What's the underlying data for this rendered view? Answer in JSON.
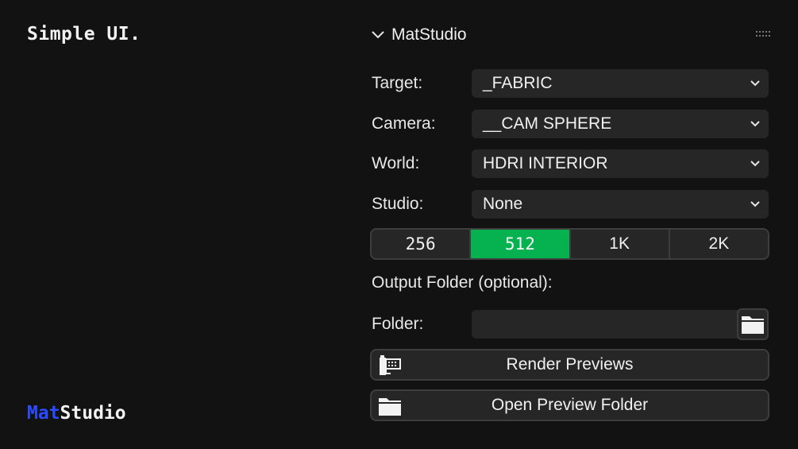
{
  "brand": {
    "top_text": "Simple UI.",
    "bottom_mat": "Mat",
    "bottom_studio": "Studio",
    "accent_color": "#2a4bff"
  },
  "panel": {
    "title": "MatStudio",
    "collapse_icon": "chevron-down-icon",
    "drag_icon": "drag-handle-icon"
  },
  "fields": [
    {
      "label": "Target:",
      "value": "_FABRIC"
    },
    {
      "label": "Camera:",
      "value": "__CAM SPHERE"
    },
    {
      "label": "World:",
      "value": "HDRI INTERIOR"
    },
    {
      "label": "Studio:",
      "value": "None"
    }
  ],
  "resolution": {
    "options": [
      "256",
      "512",
      "1K",
      "2K"
    ],
    "selected": "512",
    "active_color": "#06b24f"
  },
  "output": {
    "section_label": "Output Folder (optional):",
    "folder_label": "Folder:",
    "folder_value": "",
    "browse_icon": "folder-icon"
  },
  "actions": {
    "render_label": "Render Previews",
    "render_icon": "film-render-icon",
    "open_label": "Open Preview Folder",
    "open_icon": "folder-icon"
  }
}
